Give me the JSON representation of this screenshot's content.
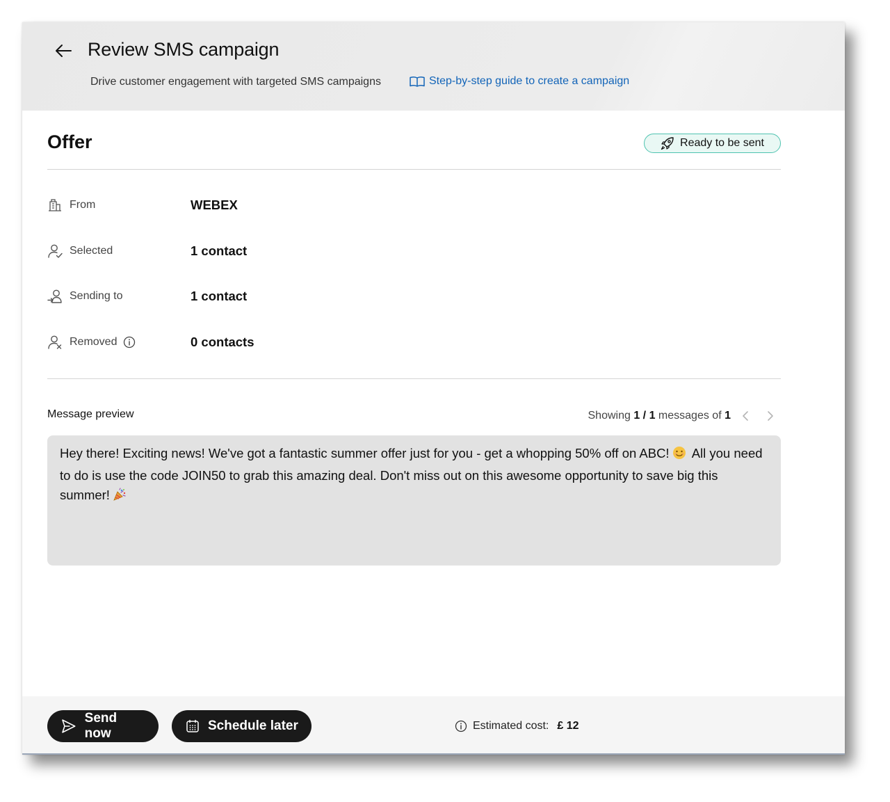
{
  "header": {
    "title": "Review SMS campaign",
    "subtitle": "Drive customer engagement with targeted SMS campaigns",
    "guide_link": "Step-by-step guide to create a campaign"
  },
  "campaign": {
    "name": "Offer",
    "status": "Ready to be sent",
    "status_color": "#4ec3b0"
  },
  "details": {
    "from": {
      "label": "From",
      "value": "WEBEX",
      "icon": "building-icon"
    },
    "selected": {
      "label": "Selected",
      "value": "1 contact",
      "icon": "user-check-icon"
    },
    "sending_to": {
      "label": "Sending to",
      "value": "1 contact",
      "icon": "user-send-icon"
    },
    "removed": {
      "label": "Removed",
      "value": "0 contacts",
      "icon": "user-remove-icon"
    }
  },
  "preview": {
    "label": "Message preview",
    "showing_prefix": "Showing",
    "showing_current": "1 / 1",
    "showing_middle": "messages of",
    "showing_total": "1",
    "message_part1": "Hey there!  Exciting news! We've got a fantastic summer offer just for you - get a whopping 50% off on ABC!",
    "message_part2": " All you need to do is use the code JOIN50 to grab this amazing deal. Don't miss out on this awesome opportunity to save big this summer!",
    "emoji1": "smiling-face-icon",
    "emoji2": "party-popper-icon"
  },
  "footer": {
    "send_now": "Send now",
    "schedule_later": "Schedule later",
    "cost_label": "Estimated cost:",
    "cost_value": "£ 12",
    "button_color": "#1a1a1a"
  }
}
